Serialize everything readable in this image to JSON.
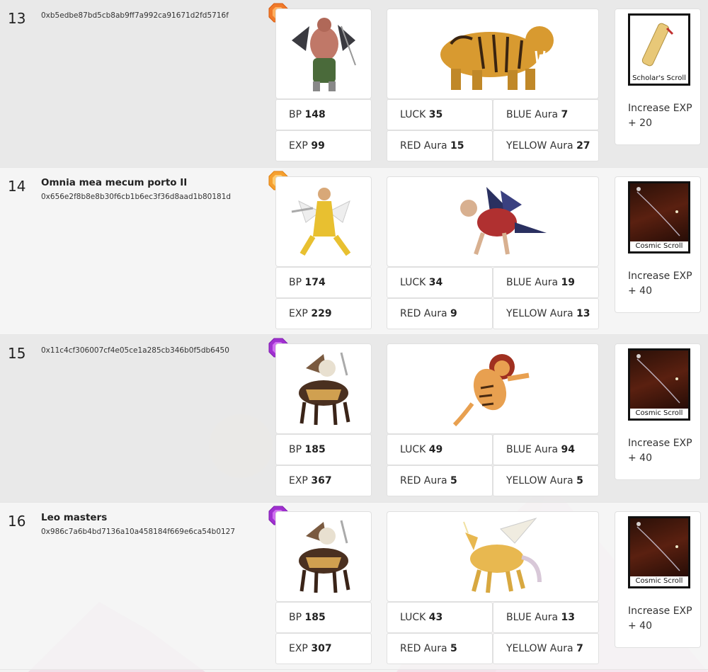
{
  "rows": [
    {
      "rank": "13",
      "team_name": "",
      "address": "0xb5edbe87bd5cb8ab9ff7a992ca91671d2fd5716f",
      "gem_color": "#f07a2a",
      "bp_label": "BP",
      "bp": "148",
      "exp_label": "EXP",
      "exp": "99",
      "luck_label": "LUCK",
      "luck": "35",
      "red_label": "RED Aura",
      "red": "15",
      "blue_label": "BLUE Aura",
      "blue": "7",
      "yellow_label": "YELLOW Aura",
      "yellow": "27",
      "scroll_name": "Scholar's Scroll",
      "scroll_effect": "Increase EXP + 20"
    },
    {
      "rank": "14",
      "team_name": "Omnia mea mecum porto II",
      "address": "0x656e2f8b8e8b30f6cb1b6ec3f36d8aad1b80181d",
      "gem_color": "#f5a030",
      "bp_label": "BP",
      "bp": "174",
      "exp_label": "EXP",
      "exp": "229",
      "luck_label": "LUCK",
      "luck": "34",
      "red_label": "RED Aura",
      "red": "9",
      "blue_label": "BLUE Aura",
      "blue": "19",
      "yellow_label": "YELLOW Aura",
      "yellow": "13",
      "scroll_name": "Cosmic Scroll",
      "scroll_effect": "Increase EXP + 40"
    },
    {
      "rank": "15",
      "team_name": "",
      "address": "0x11c4cf306007cf4e05ce1a285cb346b0f5db6450",
      "gem_color": "#a030d0",
      "bp_label": "BP",
      "bp": "185",
      "exp_label": "EXP",
      "exp": "367",
      "luck_label": "LUCK",
      "luck": "49",
      "red_label": "RED Aura",
      "red": "5",
      "blue_label": "BLUE Aura",
      "blue": "94",
      "yellow_label": "YELLOW Aura",
      "yellow": "5",
      "scroll_name": "Cosmic Scroll",
      "scroll_effect": "Increase EXP + 40"
    },
    {
      "rank": "16",
      "team_name": "Leo masters",
      "address": "0x986c7a6b4bd7136a10a458184f669e6ca54b0127",
      "gem_color": "#a030d0",
      "bp_label": "BP",
      "bp": "185",
      "exp_label": "EXP",
      "exp": "307",
      "luck_label": "LUCK",
      "luck": "43",
      "red_label": "RED Aura",
      "red": "5",
      "blue_label": "BLUE Aura",
      "blue": "13",
      "yellow_label": "YELLOW Aura",
      "yellow": "7",
      "scroll_name": "Cosmic Scroll",
      "scroll_effect": "Increase EXP + 40"
    }
  ]
}
